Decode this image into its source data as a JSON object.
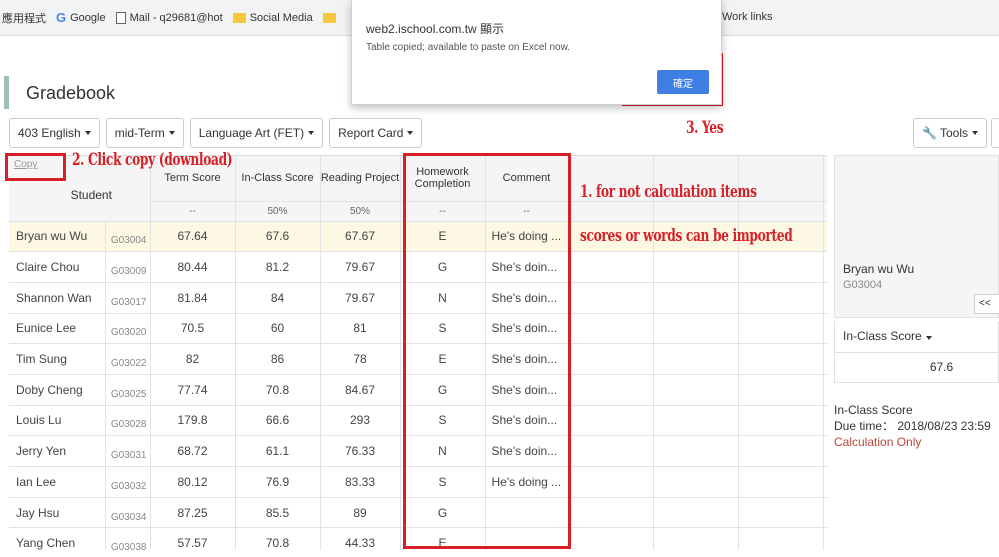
{
  "bookmarks": {
    "apps": "應用程式",
    "google": "Google",
    "mail": "Mail - q29681@hot",
    "social": "Social Media",
    "work": "Work links"
  },
  "page_title": "Gradebook",
  "toolbar": {
    "class": "403 English",
    "term": "mid-Term",
    "subject": "Language Art (FET)",
    "report": "Report Card",
    "tools": "Tools"
  },
  "table": {
    "copy": "Copy",
    "student_header": "Student",
    "columns": [
      {
        "label": "Term Score",
        "sub": "--"
      },
      {
        "label": "In-Class Score",
        "sub": "50%"
      },
      {
        "label": "Reading Project",
        "sub": "50%"
      },
      {
        "label": "Homework Completion",
        "sub": "--"
      },
      {
        "label": "Comment",
        "sub": "--"
      }
    ],
    "rows": [
      {
        "name": "Bryan wu Wu",
        "id": "G03004",
        "term": "67.64",
        "inclass": "67.6",
        "reading": "67.67",
        "homework": "E",
        "comment": "He's doing ..."
      },
      {
        "name": "Claire Chou",
        "id": "G03009",
        "term": "80.44",
        "inclass": "81.2",
        "reading": "79.67",
        "homework": "G",
        "comment": "She's doin..."
      },
      {
        "name": "Shannon Wan",
        "id": "G03017",
        "term": "81.84",
        "inclass": "84",
        "reading": "79.67",
        "homework": "N",
        "comment": "She's doin..."
      },
      {
        "name": "Eunice Lee",
        "id": "G03020",
        "term": "70.5",
        "inclass": "60",
        "reading": "81",
        "homework": "S",
        "comment": "She's doin..."
      },
      {
        "name": "Tim Sung",
        "id": "G03022",
        "term": "82",
        "inclass": "86",
        "reading": "78",
        "homework": "E",
        "comment": "She's doin..."
      },
      {
        "name": "Doby Cheng",
        "id": "G03025",
        "term": "77.74",
        "inclass": "70.8",
        "reading": "84.67",
        "homework": "G",
        "comment": "She's doin..."
      },
      {
        "name": "Louis Lu",
        "id": "G03028",
        "term": "179.8",
        "inclass": "66.6",
        "reading": "293",
        "homework": "S",
        "comment": "She's doin..."
      },
      {
        "name": "Jerry Yen",
        "id": "G03031",
        "term": "68.72",
        "inclass": "61.1",
        "reading": "76.33",
        "homework": "N",
        "comment": "She's doin..."
      },
      {
        "name": "Ian Lee",
        "id": "G03032",
        "term": "80.12",
        "inclass": "76.9",
        "reading": "83.33",
        "homework": "S",
        "comment": "He's doing ..."
      },
      {
        "name": "Jay Hsu",
        "id": "G03034",
        "term": "87.25",
        "inclass": "85.5",
        "reading": "89",
        "homework": "G",
        "comment": ""
      },
      {
        "name": "Yang Chen",
        "id": "G03038",
        "term": "57.57",
        "inclass": "70.8",
        "reading": "44.33",
        "homework": "E",
        "comment": ""
      }
    ]
  },
  "side": {
    "name": "Bryan wu Wu",
    "id": "G03004",
    "nav": "<<",
    "score_dropdown": "In-Class Score",
    "score_value": "67.6",
    "info_title": "In-Class Score",
    "due": "Due time： 2018/08/23 23:59",
    "calc": "Calculation Only"
  },
  "dialog": {
    "title": "web2.ischool.com.tw 顯示",
    "message": "Table copied; available to paste on Excel now.",
    "ok": "確定"
  },
  "annotations": {
    "step1_line1": "1. for not calculation items",
    "step1_line2": "scores or words can be imported",
    "step2": "2. Click copy (download)",
    "step3": "3. Yes"
  },
  "colors": {
    "annotation_red": "#d61f26",
    "dialog_button": "#3f7fe3",
    "selected_row": "#fcf8e3"
  }
}
